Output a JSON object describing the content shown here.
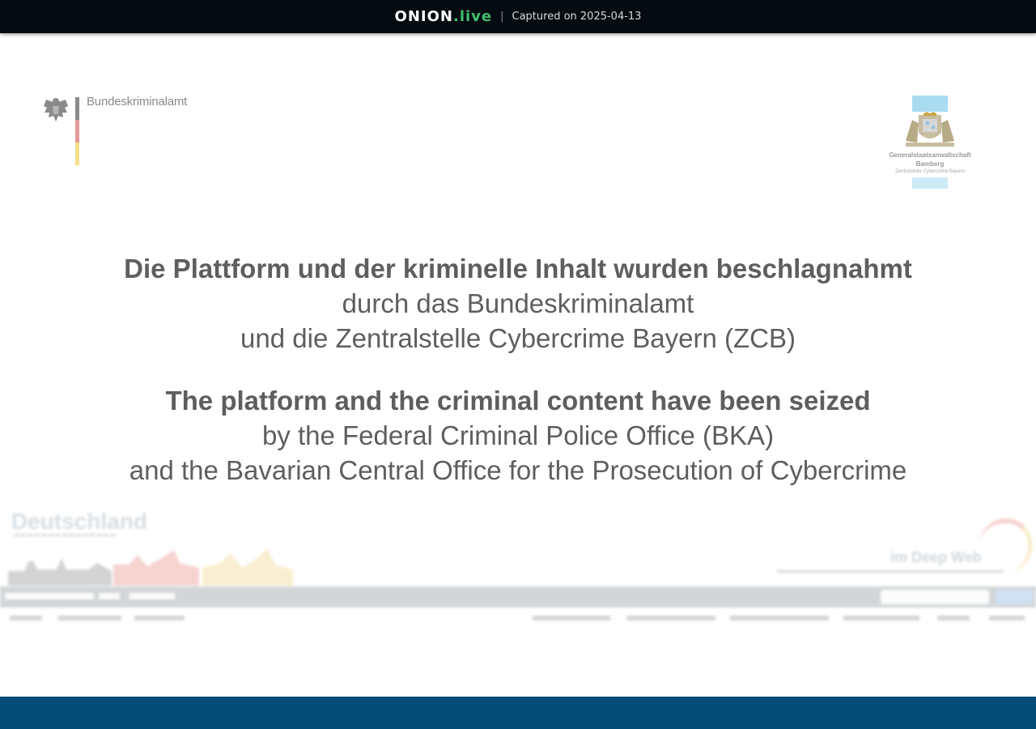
{
  "topbar": {
    "brand_main": "ONION",
    "brand_suffix": ".live",
    "separator": "|",
    "captured": "Captured on 2025-04-13"
  },
  "logos": {
    "bka_name": "Bundeskriminalamt",
    "gsa_line1": "Generalstaatsanwaltschaft",
    "gsa_line2": "Bamberg",
    "gsa_line3": "Zentralstelle Cybercrime Bayern"
  },
  "seizure": {
    "de_headline": "Die Plattform und der kriminelle Inhalt wurden beschlagnahmt",
    "de_line2": "durch das Bundeskriminalamt",
    "de_line3": "und die Zentralstelle Cybercrime Bayern (ZCB)",
    "en_headline": "The platform and the criminal content have been seized",
    "en_line2": "by the Federal Criminal Police Office (BKA)",
    "en_line3": "and the Bavarian Central Office for the Prosecution of Cybercrime"
  },
  "background_site": {
    "title": "Deutschland",
    "tagline": "im Deep Web"
  },
  "colors": {
    "topbar_bg": "#050c11",
    "brand_accent": "#3fbf6f",
    "text_gray": "#5e5e5e",
    "footer_bg": "#034c78",
    "flag_black": "#8a8a8a",
    "flag_red": "#e39a9a",
    "flag_gold": "#f3df8a",
    "bavaria_blue": "#a9dbf1"
  },
  "icons": {
    "bka_emblem": "federal-eagle-icon",
    "gsa_emblem": "bavarian-crest-icon"
  }
}
